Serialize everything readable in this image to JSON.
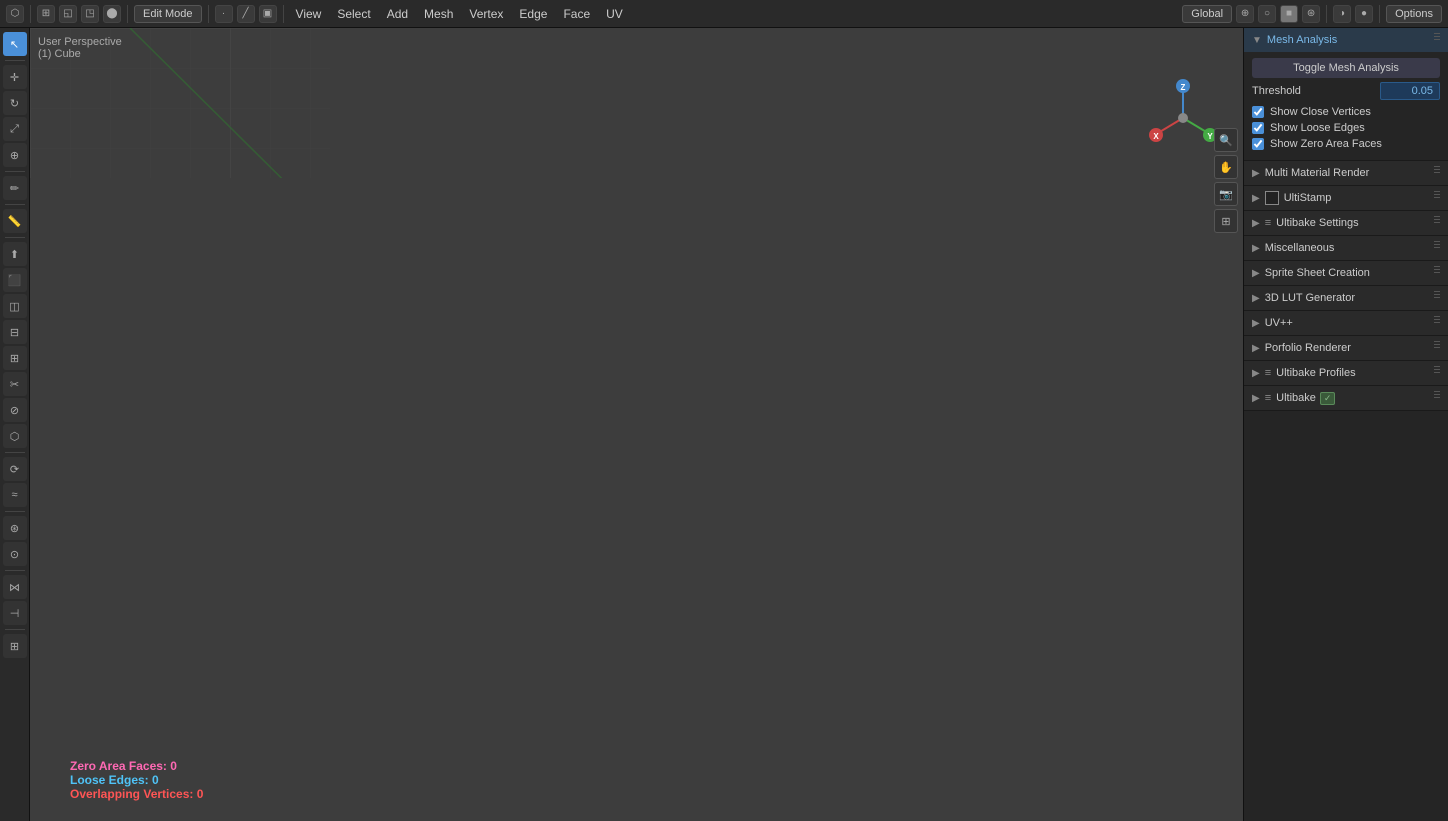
{
  "topbar": {
    "mode_label": "Edit Mode",
    "menus": [
      "View",
      "Select",
      "Add",
      "Mesh",
      "Vertex",
      "Edge",
      "Face",
      "UV"
    ],
    "transform": "Global",
    "options_label": "Options"
  },
  "viewport": {
    "label_line1": "User Perspective",
    "label_line2": "(1) Cube",
    "crosshair_symbol": "+"
  },
  "stats": {
    "zero_area": "Zero Area Faces: 0",
    "loose_edges": "Loose Edges: 0",
    "overlapping": "Overlapping Vertices: 0"
  },
  "panel": {
    "mesh_analysis": {
      "title": "Mesh Analysis",
      "toggle_label": "Toggle Mesh Analysis",
      "threshold_label": "Threshold",
      "threshold_value": "0.05",
      "show_close_vertices": "Show Close Vertices",
      "show_loose_edges": "Show Loose Edges",
      "show_zero_area": "Show Zero Area Faces"
    },
    "sections": [
      {
        "label": "Multi Material Render",
        "icon": "chevron",
        "extra": ""
      },
      {
        "label": "UltiStamp",
        "icon": "chevron",
        "extra": "checkbox"
      },
      {
        "label": "Ultibake Settings",
        "icon": "chevron",
        "extra": "list"
      },
      {
        "label": "Miscellaneous",
        "icon": "chevron",
        "extra": ""
      },
      {
        "label": "Sprite Sheet Creation",
        "icon": "chevron",
        "extra": ""
      },
      {
        "label": "3D LUT Generator",
        "icon": "chevron",
        "extra": ""
      },
      {
        "label": "UV++",
        "icon": "chevron",
        "extra": ""
      },
      {
        "label": "Porfolio Renderer",
        "icon": "chevron",
        "extra": ""
      },
      {
        "label": "Ultibake Profiles",
        "icon": "chevron",
        "extra": "list"
      },
      {
        "label": "Ultibake",
        "icon": "chevron",
        "extra": "img"
      }
    ]
  }
}
